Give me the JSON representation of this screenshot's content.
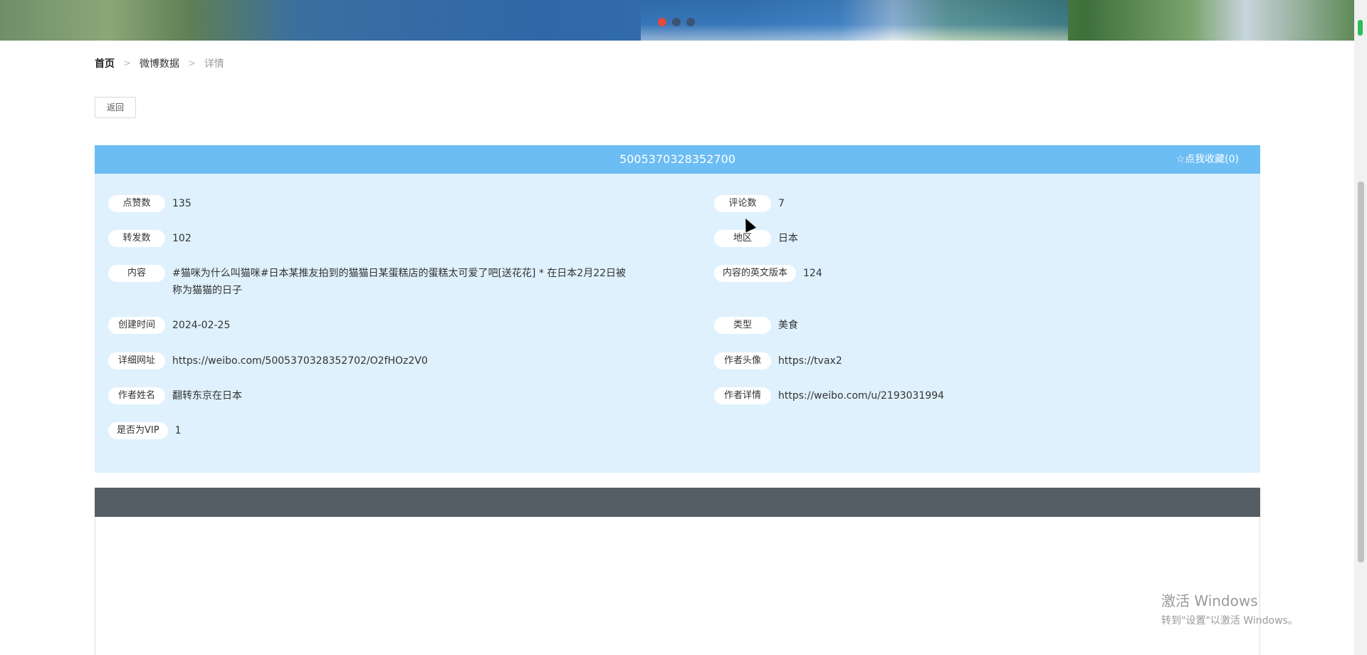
{
  "banner": {
    "active_slide": 1,
    "slide_count": 3,
    "accent_color": "#e14a3c"
  },
  "breadcrumb": {
    "home": "首页",
    "section": "微博数据",
    "current": "详情",
    "separator": ">"
  },
  "back_button": "返回",
  "detail": {
    "id_title": "5005370328352700",
    "favorite_label": "☆点我收藏(0)",
    "fields_left": [
      {
        "label": "点赞数",
        "value": "135"
      },
      {
        "label": "转发数",
        "value": "102"
      },
      {
        "label": "内容",
        "value": "#猫咪为什么叫猫咪#日本某推友拍到的猫猫日某蛋糕店的蛋糕太可爱了吧[送花花] * 在日本2月22日被称为猫猫的日子"
      },
      {
        "label": "创建时间",
        "value": "2024-02-25"
      },
      {
        "label": "详细网址",
        "value": "https://weibo.com/5005370328352702/O2fHOz2V0"
      },
      {
        "label": "作者姓名",
        "value": "翻转东京在日本"
      },
      {
        "label": "是否为VIP",
        "value": "1"
      }
    ],
    "fields_right": [
      {
        "label": "评论数",
        "value": "7"
      },
      {
        "label": "地区",
        "value": "日本"
      },
      {
        "label": "内容的英文版本",
        "value": "124"
      },
      {
        "label": "类型",
        "value": "美食"
      },
      {
        "label": "作者头像",
        "value": "https://tvax2"
      },
      {
        "label": "作者详情",
        "value": "https://weibo.com/u/2193031994"
      }
    ],
    "header_color": "#6bbdf4",
    "body_color": "#dff1fd"
  },
  "watermark": {
    "line1": "激活 Windows",
    "line2": "转到\"设置\"以激活 Windows。"
  }
}
